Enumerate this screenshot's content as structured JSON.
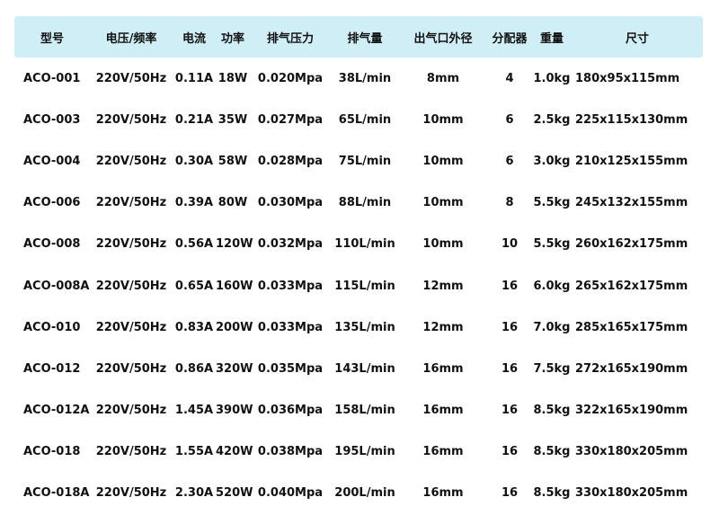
{
  "table": {
    "headers": [
      "型号",
      "电压/频率",
      "电流",
      "功率",
      "排气压力",
      "排气量",
      "出气口外径",
      "分配器",
      "重量",
      "尺寸"
    ],
    "rows": [
      [
        "ACO-001",
        "220V/50Hz",
        "0.11A",
        "18W",
        "0.020Mpa",
        "38L/min",
        "8mm",
        "4",
        "1.0kg",
        "180x95x115mm"
      ],
      [
        "ACO-003",
        "220V/50Hz",
        "0.21A",
        "35W",
        "0.027Mpa",
        "65L/min",
        "10mm",
        "6",
        "2.5kg",
        "225x115x130mm"
      ],
      [
        "ACO-004",
        "220V/50Hz",
        "0.30A",
        "58W",
        "0.028Mpa",
        "75L/min",
        "10mm",
        "6",
        "3.0kg",
        "210x125x155mm"
      ],
      [
        "ACO-006",
        "220V/50Hz",
        "0.39A",
        "80W",
        "0.030Mpa",
        "88L/min",
        "10mm",
        "8",
        "5.5kg",
        "245x132x155mm"
      ],
      [
        "ACO-008",
        "220V/50Hz",
        "0.56A",
        "120W",
        "0.032Mpa",
        "110L/min",
        "10mm",
        "10",
        "5.5kg",
        "260x162x175mm"
      ],
      [
        "ACO-008A",
        "220V/50Hz",
        "0.65A",
        "160W",
        "0.033Mpa",
        "115L/min",
        "12mm",
        "16",
        "6.0kg",
        "265x162x175mm"
      ],
      [
        "ACO-010",
        "220V/50Hz",
        "0.83A",
        "200W",
        "0.033Mpa",
        "135L/min",
        "12mm",
        "16",
        "7.0kg",
        "285x165x175mm"
      ],
      [
        "ACO-012",
        "220V/50Hz",
        "0.86A",
        "320W",
        "0.035Mpa",
        "143L/min",
        "16mm",
        "16",
        "7.5kg",
        "272x165x190mm"
      ],
      [
        "ACO-012A",
        "220V/50Hz",
        "1.45A",
        "390W",
        "0.036Mpa",
        "158L/min",
        "16mm",
        "16",
        "8.5kg",
        "322x165x190mm"
      ],
      [
        "ACO-018",
        "220V/50Hz",
        "1.55A",
        "420W",
        "0.038Mpa",
        "195L/min",
        "16mm",
        "16",
        "8.5kg",
        "330x180x205mm"
      ],
      [
        "ACO-018A",
        "220V/50Hz",
        "2.30A",
        "520W",
        "0.040Mpa",
        "200L/min",
        "16mm",
        "16",
        "8.5kg",
        "330x180x205mm"
      ]
    ]
  },
  "colors": {
    "header_background": "#cfeef6",
    "text": "#111111",
    "page_background": "#ffffff"
  }
}
